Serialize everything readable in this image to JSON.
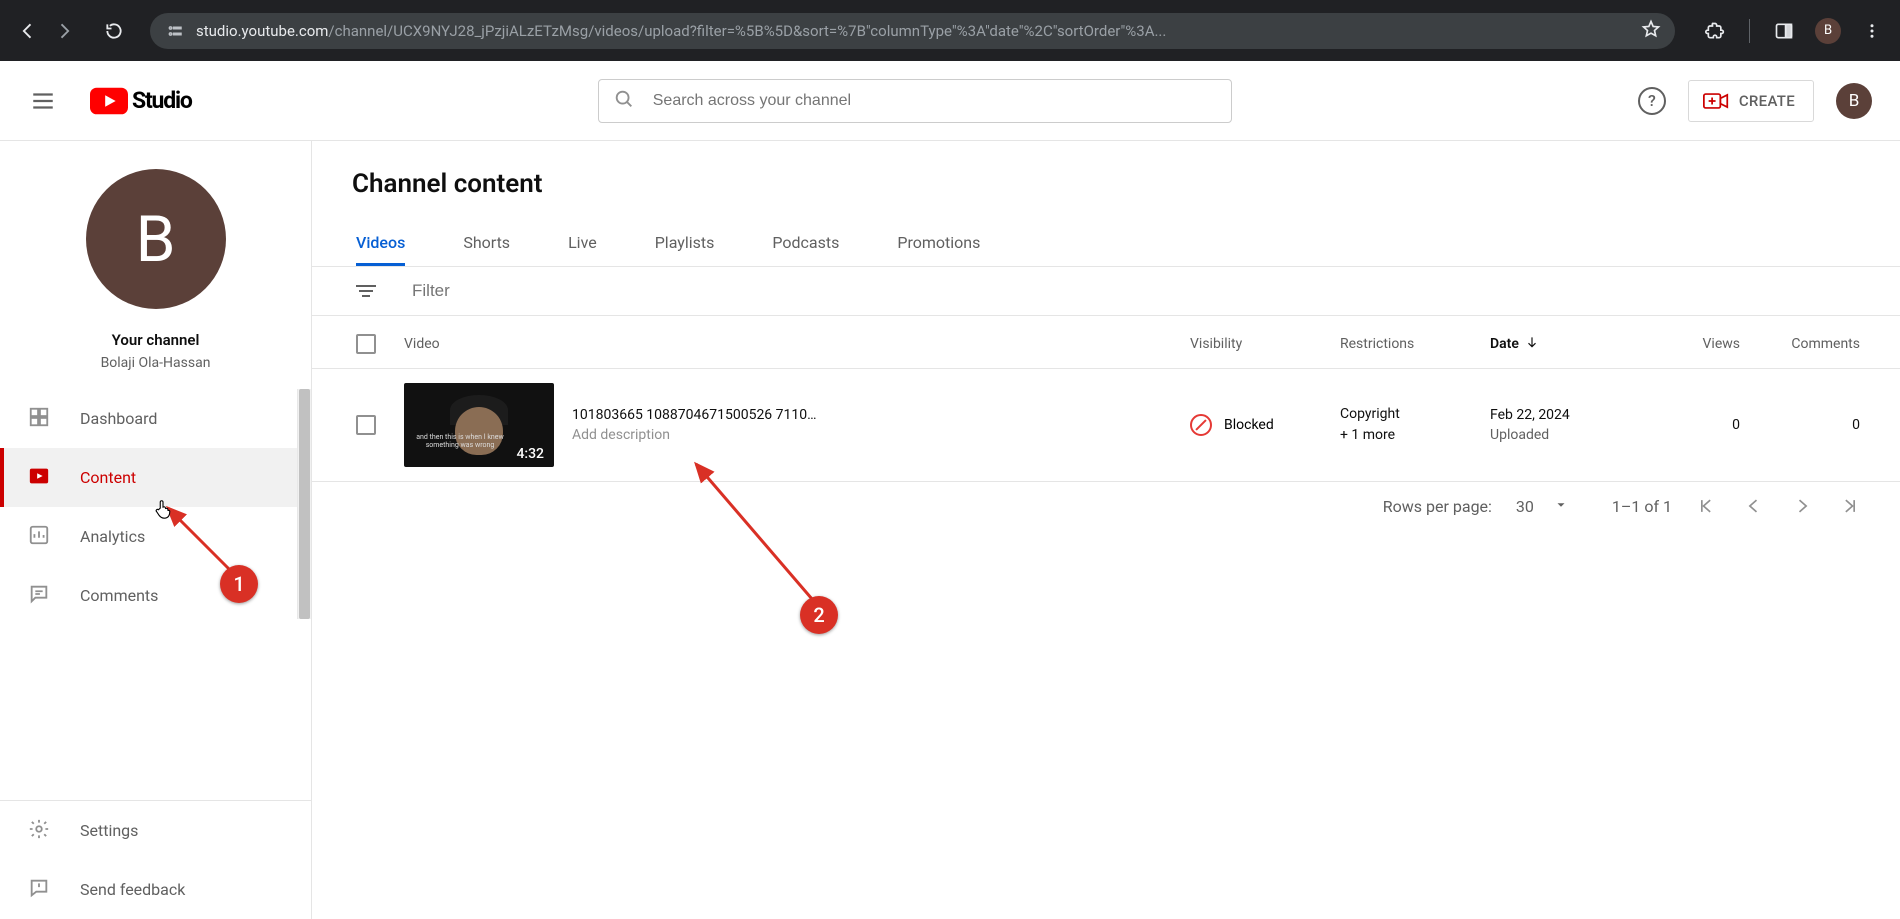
{
  "browser": {
    "url_host": "studio.youtube.com",
    "url_path": "/channel/UCX9NYJ28_jPzjiALzETzMsg/videos/upload?filter=%5B%5D&sort=%7B\"columnType\"%3A\"date\"%2C\"sortOrder\"%3A...",
    "avatar_letter": "B"
  },
  "studio": {
    "logo_text": "Studio",
    "search_placeholder": "Search across your channel",
    "create_label": "CREATE",
    "avatar_letter": "B"
  },
  "channel": {
    "avatar_letter": "B",
    "your_channel_label": "Your channel",
    "name": "Bolaji Ola-Hassan"
  },
  "sidebar": {
    "items": [
      "Dashboard",
      "Content",
      "Analytics",
      "Comments"
    ],
    "bottom": [
      "Settings",
      "Send feedback"
    ],
    "active": "Content"
  },
  "page": {
    "title": "Channel content",
    "tabs": [
      "Videos",
      "Shorts",
      "Live",
      "Playlists",
      "Podcasts",
      "Promotions"
    ],
    "active_tab": "Videos",
    "filter_placeholder": "Filter"
  },
  "table": {
    "headers": {
      "video": "Video",
      "visibility": "Visibility",
      "restrictions": "Restrictions",
      "date": "Date",
      "views": "Views",
      "comments": "Comments"
    },
    "rows": [
      {
        "title": "101803665 1088704671500526 7110…",
        "description": "Add description",
        "duration": "4:32",
        "caption": "and then this is when I knew something was wrong",
        "visibility": "Blocked",
        "restrictions_main": "Copyright",
        "restrictions_sub": "+ 1 more",
        "date": "Feb 22, 2024",
        "date_sub": "Uploaded",
        "views": "0",
        "comments": "0"
      }
    ]
  },
  "pager": {
    "rpp_label": "Rows per page:",
    "rpp_value": "30",
    "range": "1–1 of 1"
  },
  "annotations": {
    "one": "1",
    "two": "2"
  }
}
